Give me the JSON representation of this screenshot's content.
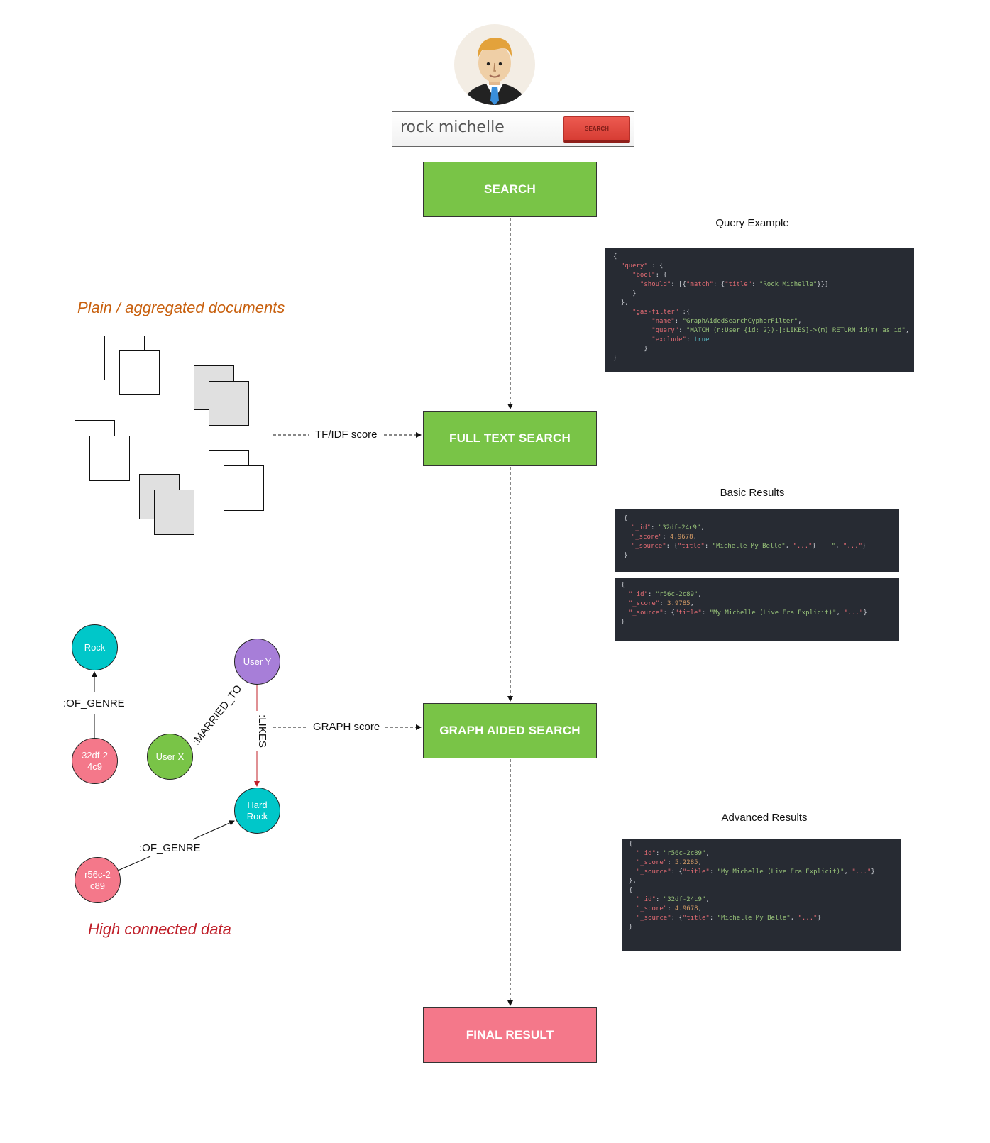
{
  "user": {
    "avatar": "businessman-avatar"
  },
  "search_box": {
    "query": "rock michelle",
    "button_label": "SEARCH"
  },
  "steps": {
    "search": "SEARCH",
    "full_text_search": "FULL TEXT SEARCH",
    "graph_aided_search": "GRAPH AIDED SEARCH",
    "final_result": "FINAL RESULT"
  },
  "colors": {
    "green_step": "#79c447",
    "final_step": "#f4788a",
    "code_bg": "#272b33"
  },
  "edges": {
    "tfidf": "TF/IDF score",
    "graph": "GRAPH score"
  },
  "captions": {
    "documents": "Plain / aggregated documents",
    "graph": "High connected data"
  },
  "panels": {
    "query_example": {
      "title": "Query Example",
      "lines": [
        [
          [
            "p",
            "{"
          ]
        ],
        [
          [
            "p",
            "  "
          ],
          [
            "k",
            "\"query\""
          ],
          [
            "p",
            " : {"
          ]
        ],
        [
          [
            "p",
            "     "
          ],
          [
            "k",
            "\"bool\""
          ],
          [
            "p",
            ": {"
          ]
        ],
        [
          [
            "p",
            "       "
          ],
          [
            "k",
            "\"should\""
          ],
          [
            "p",
            ": [{"
          ],
          [
            "k",
            "\"match\""
          ],
          [
            "p",
            ": {"
          ],
          [
            "k",
            "\"title\""
          ],
          [
            "p",
            ": "
          ],
          [
            "s",
            "\"Rock Michelle\""
          ],
          [
            "p",
            "}}]"
          ]
        ],
        [
          [
            "p",
            "     }"
          ]
        ],
        [
          [
            "p",
            "  },"
          ]
        ],
        [
          [
            "p",
            "     "
          ],
          [
            "k",
            "\"gas-filter\""
          ],
          [
            "p",
            " :{"
          ]
        ],
        [
          [
            "p",
            "          "
          ],
          [
            "k",
            "\"name\""
          ],
          [
            "p",
            ": "
          ],
          [
            "s",
            "\"GraphAidedSearchCypherFilter\""
          ],
          [
            "p",
            ","
          ]
        ],
        [
          [
            "p",
            "          "
          ],
          [
            "k",
            "\"query\""
          ],
          [
            "p",
            ": "
          ],
          [
            "s",
            "\"MATCH (n:User {id: 2})-[:LIKES]->(m) RETURN id(m) as id\""
          ],
          [
            "p",
            ","
          ]
        ],
        [
          [
            "p",
            "          "
          ],
          [
            "k",
            "\"exclude\""
          ],
          [
            "p",
            ": "
          ],
          [
            "b",
            "true"
          ]
        ],
        [
          [
            "p",
            "        }"
          ]
        ],
        [
          [
            "p",
            "}"
          ]
        ]
      ]
    },
    "basic_results": {
      "title": "Basic Results",
      "blocks": [
        [
          [
            [
              "p",
              "{"
            ]
          ],
          [
            [
              "p",
              "  "
            ],
            [
              "k",
              "\"_id\""
            ],
            [
              "p",
              ": "
            ],
            [
              "s",
              "\"32df-24c9\""
            ],
            [
              "p",
              ","
            ]
          ],
          [
            [
              "p",
              "  "
            ],
            [
              "k",
              "\"_score\""
            ],
            [
              "p",
              ": "
            ],
            [
              "n",
              "4.9678"
            ],
            [
              "p",
              ","
            ]
          ],
          [
            [
              "p",
              "  "
            ],
            [
              "k",
              "\"_source\""
            ],
            [
              "p",
              ": {"
            ],
            [
              "k",
              "\"title\""
            ],
            [
              "p",
              ": "
            ],
            [
              "s",
              "\"Michelle My Belle\""
            ],
            [
              "p",
              ", "
            ],
            [
              "k",
              "\"...\""
            ],
            [
              "p",
              "}    "
            ],
            [
              "s",
              "\""
            ],
            [
              "p",
              ", "
            ],
            [
              "k",
              "\"...\""
            ],
            [
              "p",
              "}"
            ]
          ],
          [
            [
              "p",
              "}"
            ]
          ]
        ],
        [
          [
            [
              "p",
              "{"
            ]
          ],
          [
            [
              "p",
              "  "
            ],
            [
              "k",
              "\"_id\""
            ],
            [
              "p",
              ": "
            ],
            [
              "s",
              "\"r56c-2c89\""
            ],
            [
              "p",
              ","
            ]
          ],
          [
            [
              "p",
              "  "
            ],
            [
              "k",
              "\"_score\""
            ],
            [
              "p",
              ": "
            ],
            [
              "n",
              "3.9785"
            ],
            [
              "p",
              ","
            ]
          ],
          [
            [
              "p",
              "  "
            ],
            [
              "k",
              "\"_source\""
            ],
            [
              "p",
              ": {"
            ],
            [
              "k",
              "\"title\""
            ],
            [
              "p",
              ": "
            ],
            [
              "s",
              "\"My Michelle (Live Era Explicit)\""
            ],
            [
              "p",
              ", "
            ],
            [
              "k",
              "\"...\""
            ],
            [
              "p",
              "}"
            ]
          ],
          [
            [
              "p",
              "}"
            ]
          ]
        ]
      ]
    },
    "advanced_results": {
      "title": "Advanced Results",
      "lines": [
        [
          [
            "p",
            "{"
          ]
        ],
        [
          [
            "p",
            "  "
          ],
          [
            "k",
            "\"_id\""
          ],
          [
            "p",
            ": "
          ],
          [
            "s",
            "\"r56c-2c89\""
          ],
          [
            "p",
            ","
          ]
        ],
        [
          [
            "p",
            "  "
          ],
          [
            "k",
            "\"_score\""
          ],
          [
            "p",
            ": "
          ],
          [
            "n",
            "5.2285"
          ],
          [
            "p",
            ","
          ]
        ],
        [
          [
            "p",
            "  "
          ],
          [
            "k",
            "\"_source\""
          ],
          [
            "p",
            ": {"
          ],
          [
            "k",
            "\"title\""
          ],
          [
            "p",
            ": "
          ],
          [
            "s",
            "\"My Michelle (Live Era Explicit)\""
          ],
          [
            "p",
            ", "
          ],
          [
            "k",
            "\"...\""
          ],
          [
            "p",
            "}"
          ]
        ],
        [
          [
            "p",
            "},"
          ]
        ],
        [
          [
            "p",
            "{"
          ]
        ],
        [
          [
            "p",
            "  "
          ],
          [
            "k",
            "\"_id\""
          ],
          [
            "p",
            ": "
          ],
          [
            "s",
            "\"32df-24c9\""
          ],
          [
            "p",
            ","
          ]
        ],
        [
          [
            "p",
            "  "
          ],
          [
            "k",
            "\"_score\""
          ],
          [
            "p",
            ": "
          ],
          [
            "n",
            "4.9678"
          ],
          [
            "p",
            ","
          ]
        ],
        [
          [
            "p",
            "  "
          ],
          [
            "k",
            "\"_source\""
          ],
          [
            "p",
            ": {"
          ],
          [
            "k",
            "\"title\""
          ],
          [
            "p",
            ": "
          ],
          [
            "s",
            "\"Michelle My Belle\""
          ],
          [
            "p",
            ", "
          ],
          [
            "k",
            "\"...\""
          ],
          [
            "p",
            "}"
          ]
        ],
        [
          [
            "p",
            "}"
          ]
        ]
      ]
    }
  },
  "graph": {
    "nodes": {
      "rock": {
        "label": "Rock",
        "color": "#00c7c9"
      },
      "doc1": {
        "label": "32df-2\n4c9",
        "color": "#f4788a"
      },
      "user_y": {
        "label": "User Y",
        "color": "#a77ed8"
      },
      "user_x": {
        "label": "User X",
        "color": "#79c447"
      },
      "hard_rock": {
        "label": "Hard\nRock",
        "color": "#00c7c9"
      },
      "doc2": {
        "label": "r56c-2\nc89",
        "color": "#f4788a"
      }
    },
    "relationships": {
      "of_genre_1": ":OF_GENRE",
      "married_to": ":MARRIED_TO",
      "likes": ":LIKES",
      "of_genre_2": ":OF_GENRE"
    }
  }
}
